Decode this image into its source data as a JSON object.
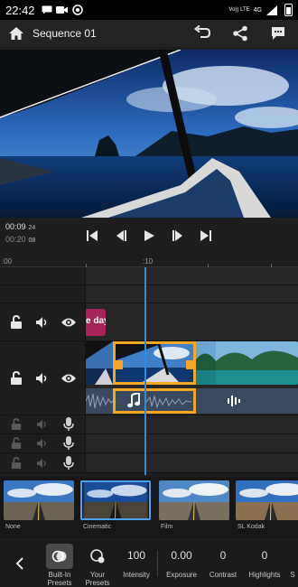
{
  "status": {
    "time": "22:42",
    "network": "4G",
    "carrier": "Vo)) LTE"
  },
  "header": {
    "title": "Sequence 01"
  },
  "player": {
    "current_time": "00:09",
    "current_frames": "24",
    "total_time": "00:20",
    "total_frames": "08"
  },
  "ruler": {
    "start_label": ":00",
    "mid_label": ":10"
  },
  "timeline": {
    "title_clip_text": "e day"
  },
  "filters": [
    {
      "name": "None",
      "selected": false
    },
    {
      "name": "Cinematic",
      "selected": true
    },
    {
      "name": "Film",
      "selected": false
    },
    {
      "name": "SL Kodak",
      "selected": false
    }
  ],
  "toolbar": {
    "items": [
      {
        "label": "Built-In Presets",
        "value": "",
        "active": true
      },
      {
        "label": "Your Presets",
        "value": "",
        "active": false
      },
      {
        "label": "Intensity",
        "value": "100",
        "active": false
      },
      {
        "label": "Exposure",
        "value": "0.00",
        "active": false
      },
      {
        "label": "Contrast",
        "value": "0",
        "active": false
      },
      {
        "label": "Highlights",
        "value": "0",
        "active": false
      },
      {
        "label": "S",
        "value": "",
        "active": false
      }
    ]
  },
  "colors": {
    "accent": "#2d8ce6",
    "selection": "#f5a623",
    "title_clip": "#a8235a"
  }
}
